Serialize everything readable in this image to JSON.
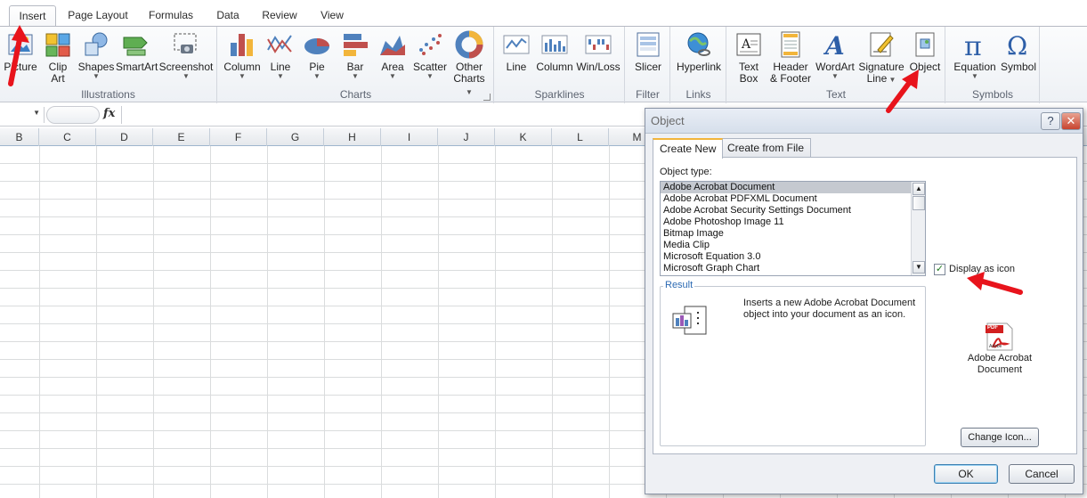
{
  "ribbon": {
    "tabs": [
      {
        "label": "Insert",
        "active": true
      },
      {
        "label": "Page Layout"
      },
      {
        "label": "Formulas"
      },
      {
        "label": "Data"
      },
      {
        "label": "Review"
      },
      {
        "label": "View"
      }
    ],
    "groups": {
      "illustrations": {
        "label": "Illustrations",
        "buttons": [
          "Picture",
          "Clip Art",
          "Shapes",
          "SmartArt",
          "Screenshot"
        ]
      },
      "charts": {
        "label": "Charts",
        "buttons": [
          "Column",
          "Line",
          "Pie",
          "Bar",
          "Area",
          "Scatter",
          "Other Charts"
        ]
      },
      "sparklines": {
        "label": "Sparklines",
        "buttons": [
          "Line",
          "Column",
          "Win/Loss"
        ]
      },
      "filter": {
        "label": "Filter",
        "buttons": [
          "Slicer"
        ]
      },
      "links": {
        "label": "Links",
        "buttons": [
          "Hyperlink"
        ]
      },
      "text": {
        "label": "Text",
        "buttons": [
          "Text Box",
          "Header & Footer",
          "WordArt",
          "Signature Line",
          "Object"
        ]
      },
      "symbols": {
        "label": "Symbols",
        "buttons": [
          "Equation",
          "Symbol"
        ]
      }
    },
    "clip_art_lines": [
      "Clip",
      "Art"
    ],
    "other_charts_lines": [
      "Other",
      "Charts"
    ],
    "text_box_lines": [
      "Text",
      "Box"
    ],
    "header_footer_lines": [
      "Header",
      "& Footer"
    ],
    "signature_lines": [
      "Signature",
      "Line"
    ]
  },
  "formula_bar": {
    "fx": "fx"
  },
  "columns": [
    "B",
    "C",
    "D",
    "E",
    "F",
    "G",
    "H",
    "I",
    "J",
    "K",
    "L",
    "M"
  ],
  "dialog": {
    "title": "Object",
    "help": "?",
    "close": "✕",
    "tabs": [
      "Create New",
      "Create from File"
    ],
    "object_type_label": "Object type:",
    "object_types": [
      "Adobe Acrobat Document",
      "Adobe Acrobat PDFXML Document",
      "Adobe Acrobat Security Settings Document",
      "Adobe Photoshop Image 11",
      "Bitmap Image",
      "Media Clip",
      "Microsoft Equation 3.0",
      "Microsoft Graph Chart"
    ],
    "selected_type": "Adobe Acrobat Document",
    "display_as_icon_label": "Display as icon",
    "display_as_icon_checked": true,
    "result_label": "Result",
    "result_text": "Inserts a new Adobe Acrobat Document object into your document as an icon.",
    "icon_caption": "Adobe Acrobat Document",
    "icon_caption_lines": [
      "Adobe Acrobat",
      "Document"
    ],
    "pdf_badge": "PDF",
    "adobe_label": "Adobe",
    "change_icon_label": "Change Icon...",
    "ok_label": "OK",
    "cancel_label": "Cancel"
  },
  "colors": {
    "annotation_arrow": "#e8141c",
    "tab_highlight": "#f2b53b"
  }
}
